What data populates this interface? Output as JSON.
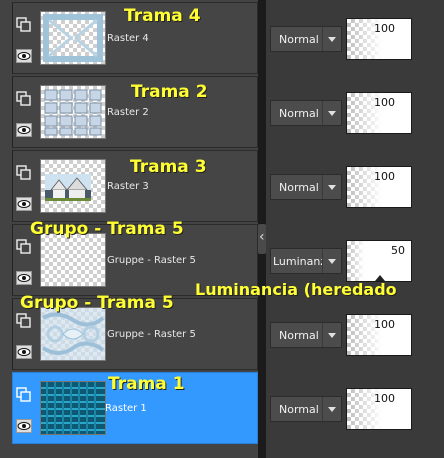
{
  "layers": [
    {
      "name": "Raster 4",
      "overlay": "Trama 4",
      "blend": "Normal",
      "opacity": "100",
      "thumb": "lattice-light"
    },
    {
      "name": "Raster 2",
      "overlay": "Trama 2",
      "blend": "Normal",
      "opacity": "100",
      "thumb": "grid-panels"
    },
    {
      "name": "Raster 3",
      "overlay": "Trama 3",
      "blend": "Normal",
      "opacity": "100",
      "thumb": "house-photo"
    },
    {
      "name": "Gruppe - Raster 5",
      "overlay": "Grupo - Trama 5",
      "blend": "Luminanz (V",
      "opacity": "50",
      "thumb": "transparent"
    },
    {
      "name": "Gruppe - Raster 5",
      "overlay": "Grupo - Trama 5",
      "blend": "Normal",
      "opacity": "100",
      "thumb": "blue-swirl"
    },
    {
      "name": "Raster 1",
      "overlay": "Trama 1",
      "blend": "Normal",
      "opacity": "100",
      "thumb": "blue-weave"
    }
  ],
  "annotation": "Luminancia (heredado",
  "selected_layer": "Raster 1",
  "colors": {
    "selection": "#3399ff",
    "overlay_text": "#ffff33"
  },
  "icons": {
    "group": "layer-group-icon",
    "visibility": "eye-icon",
    "dropdown": "chevron-down-icon"
  }
}
